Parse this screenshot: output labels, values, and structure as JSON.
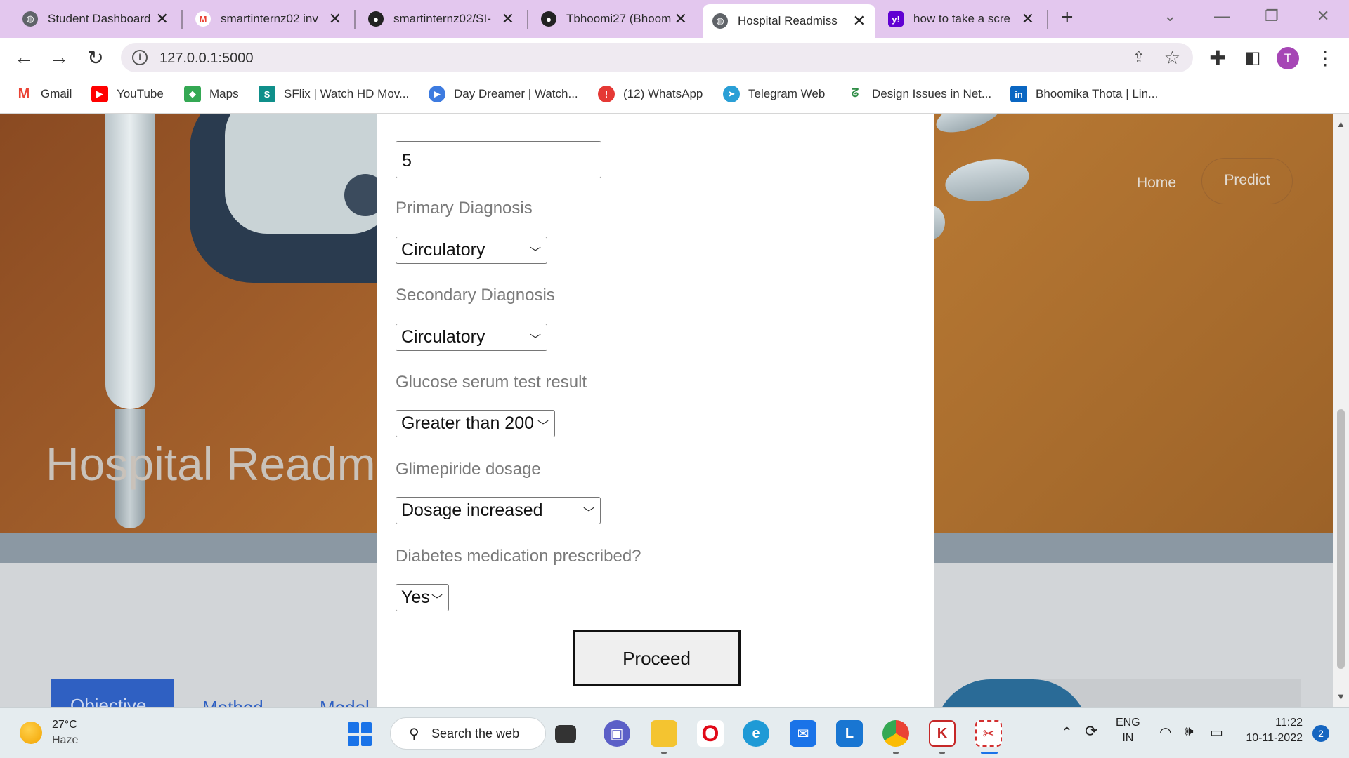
{
  "browser": {
    "tabs": [
      {
        "title": "Student Dashboard",
        "favicon": "globe-icon",
        "color": "#5f6368"
      },
      {
        "title": "smartinternz02 inv",
        "favicon": "gmail-icon",
        "color": "#ea4335"
      },
      {
        "title": "smartinternz02/SI-",
        "favicon": "github-icon",
        "color": "#222222"
      },
      {
        "title": "Tbhoomi27 (Bhoom",
        "favicon": "github-icon",
        "color": "#222222"
      },
      {
        "title": "Hospital Readmiss",
        "favicon": "globe-icon",
        "color": "#5f6368"
      },
      {
        "title": "how to take a scre",
        "favicon": "yahoo-icon",
        "color": "#6001d2"
      }
    ],
    "active_tab_index": 4,
    "new_tab_label": "+",
    "url": "127.0.0.1:5000",
    "profile_initial": "T",
    "bookmarks": [
      {
        "label": "Gmail",
        "icon": "gmail-icon",
        "color": "#ea4335"
      },
      {
        "label": "YouTube",
        "icon": "youtube-icon",
        "color": "#ff0000"
      },
      {
        "label": "Maps",
        "icon": "maps-icon",
        "color": "#34a853"
      },
      {
        "label": "SFlix | Watch HD Mov...",
        "icon": "sflix-icon",
        "color": "#0f8f8a"
      },
      {
        "label": "Day Dreamer | Watch...",
        "icon": "play-icon",
        "color": "#3d7be0"
      },
      {
        "label": "(12) WhatsApp",
        "icon": "alert-icon",
        "color": "#e53935"
      },
      {
        "label": "Telegram Web",
        "icon": "telegram-icon",
        "color": "#2a9fd6"
      },
      {
        "label": "Design Issues in Net...",
        "icon": "gfg-icon",
        "color": "#2f8d46"
      },
      {
        "label": "Bhoomika Thota | Lin...",
        "icon": "linkedin-icon",
        "color": "#0a66c2"
      }
    ]
  },
  "page": {
    "hero_title": "Hospital Readm",
    "nav": {
      "home": "Home",
      "predict": "Predict"
    },
    "section_tabs": [
      "Objective",
      "Method",
      "Model"
    ],
    "form": {
      "field_value": "5",
      "primary_diagnosis": {
        "label": "Primary Diagnosis",
        "value": "Circulatory"
      },
      "secondary_diagnosis": {
        "label": "Secondary Diagnosis",
        "value": "Circulatory"
      },
      "glucose": {
        "label": "Glucose serum test result",
        "value": "Greater than 200"
      },
      "glimepiride": {
        "label": "Glimepiride dosage",
        "value": "Dosage increased"
      },
      "diabetes_med": {
        "label": "Diabetes medication prescribed?",
        "value": "Yes"
      },
      "submit_label": "Proceed"
    }
  },
  "taskbar": {
    "weather": {
      "temp": "27°C",
      "condition": "Haze"
    },
    "search_label": "Search the web",
    "apps": [
      "file-explorer-icon",
      "teams-icon",
      "folder-icon",
      "opera-icon",
      "edge-icon",
      "mail-icon",
      "l-app-icon",
      "chrome-icon",
      "wps-icon",
      "snipping-tool-icon"
    ],
    "language": {
      "line1": "ENG",
      "line2": "IN"
    },
    "clock": {
      "time": "11:22",
      "date": "10-11-2022"
    },
    "notifications": "2"
  }
}
